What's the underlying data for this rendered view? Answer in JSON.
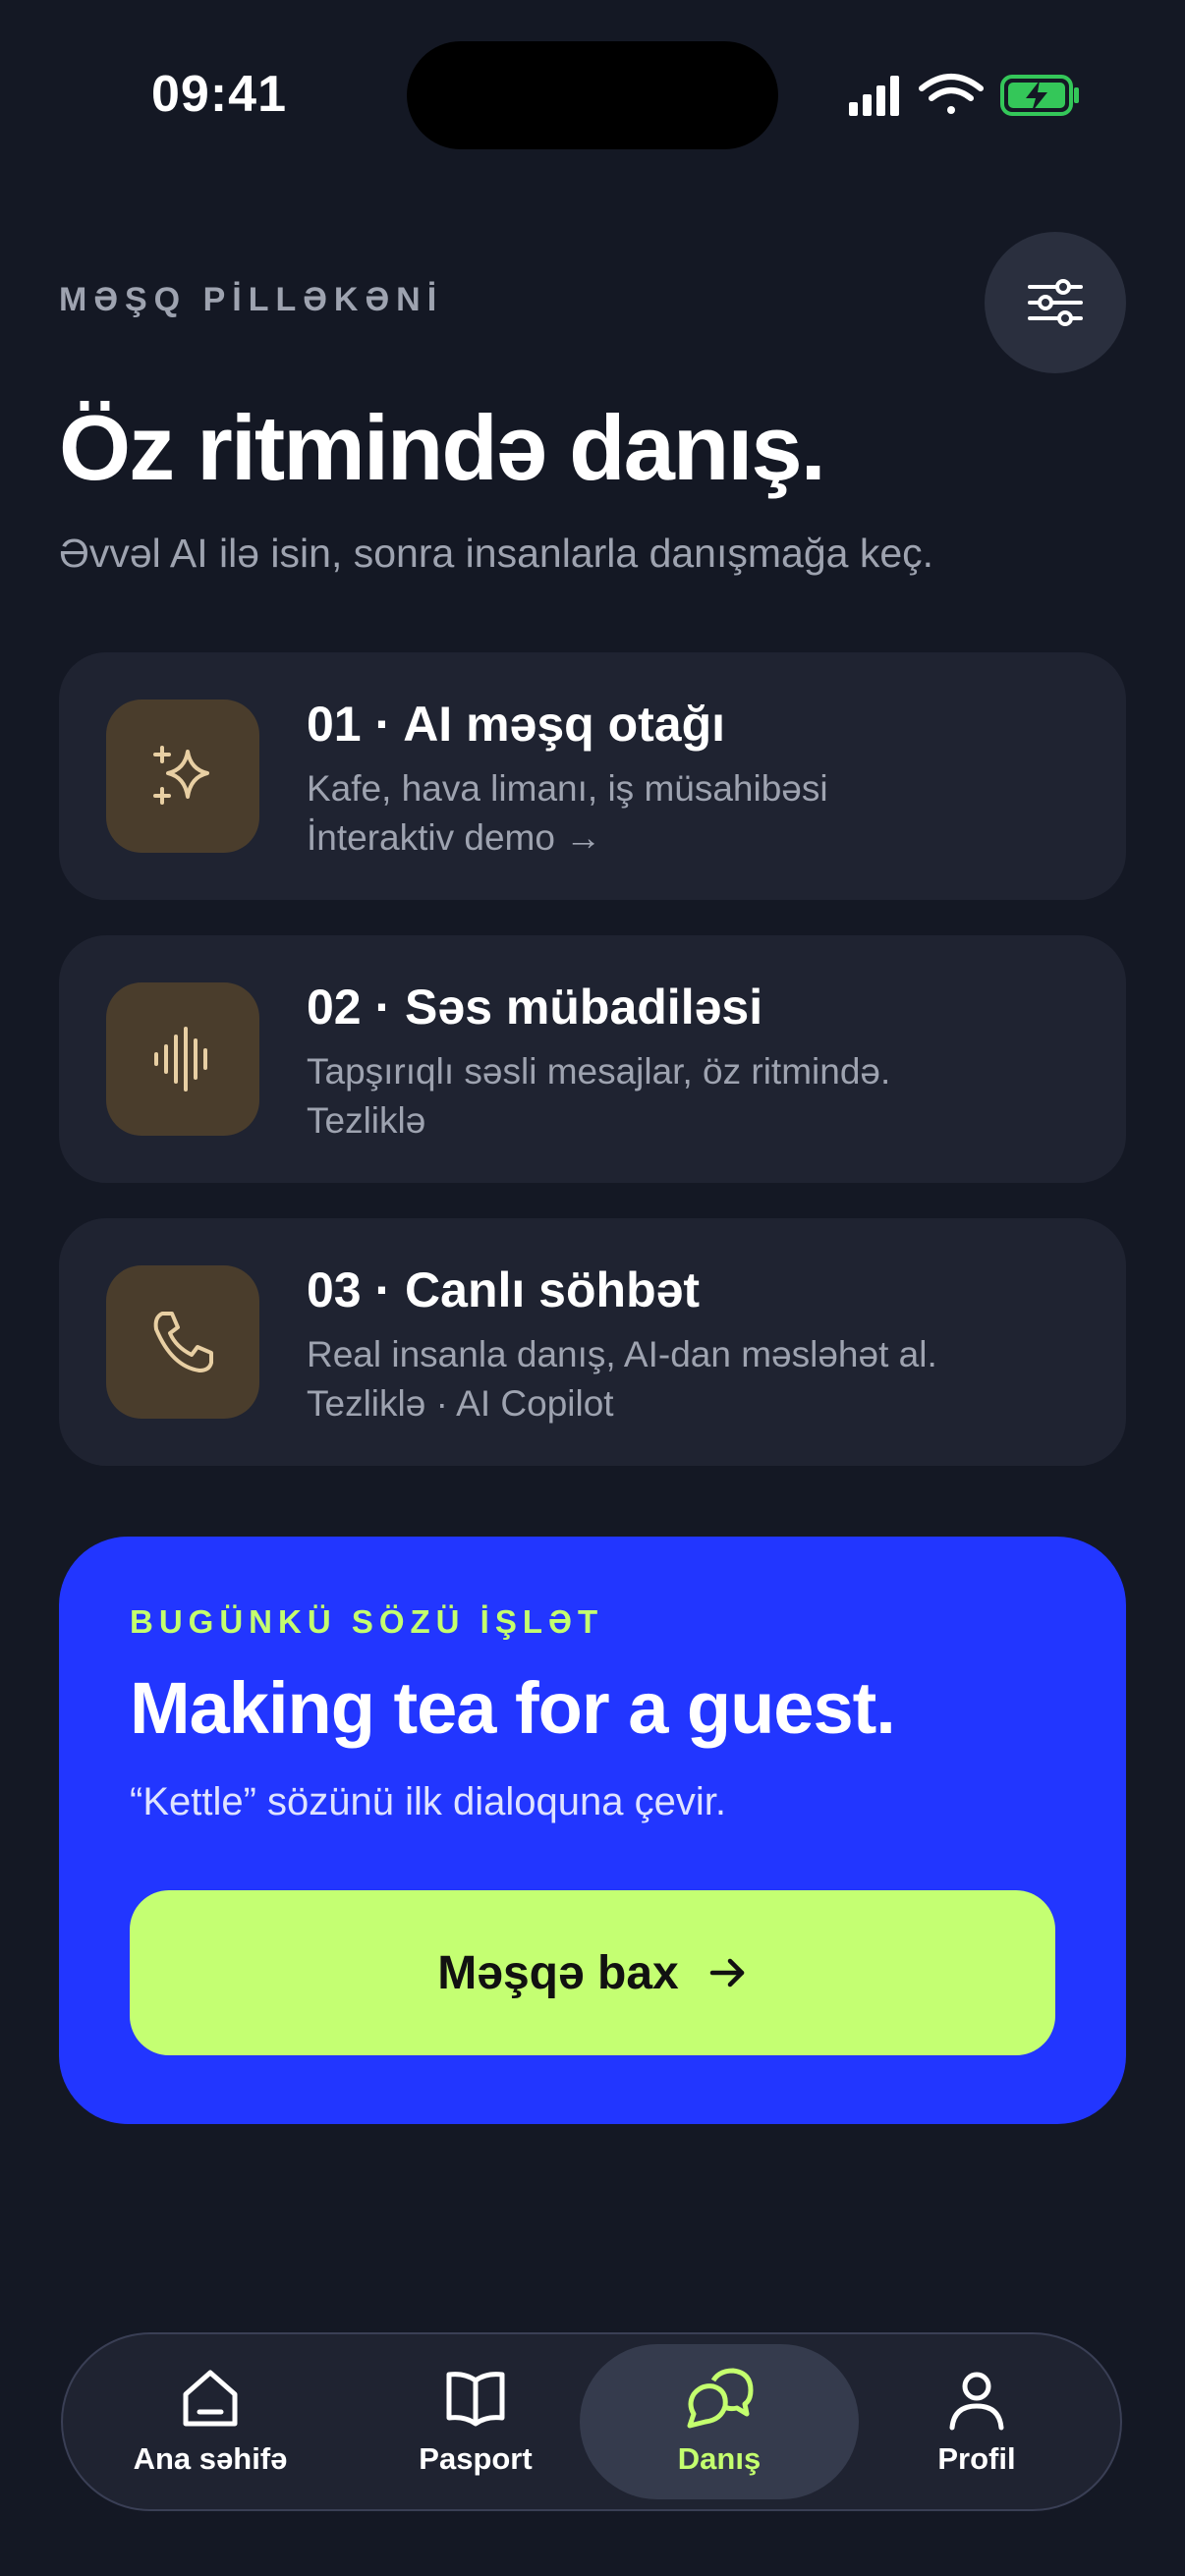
{
  "status": {
    "time": "09:41",
    "colors": {
      "battery": "#34c759"
    }
  },
  "header": {
    "eyebrow": "MƏŞQ PİLLƏKƏNİ",
    "title": "Öz ritmində danış.",
    "subtitle": "Əvvəl AI ilə isin, sonra insanlarla danışmağa keç.",
    "settings_icon": "sliders-icon"
  },
  "steps": [
    {
      "title": "01 · AI məşq otağı",
      "desc": "Kafe, hava limanı, iş müsahibəsi",
      "meta": "İnteraktiv demo →",
      "icon": "sparkles-icon"
    },
    {
      "title": "02 · Səs mübadiləsi",
      "desc": "Tapşırıqlı səsli mesajlar, öz ritmində.",
      "meta": "Tezliklə",
      "icon": "waveform-icon"
    },
    {
      "title": "03 · Canlı söhbət",
      "desc": "Real insanla danış, AI-dan məsləhət al.",
      "meta": "Tezliklə · AI Copilot",
      "icon": "phone-icon"
    }
  ],
  "promo": {
    "eyebrow": "BUGÜNKÜ SÖZÜ İŞLƏT",
    "title": "Making tea for a guest.",
    "subtitle": "“Kettle” sözünü ilk dialoquna çevir.",
    "button": "Məşqə bax",
    "colors": {
      "background": "#2236ff",
      "accent": "#c4ff72"
    }
  },
  "tabs": [
    {
      "label": "Ana səhifə",
      "icon": "home-icon",
      "active": false
    },
    {
      "label": "Pasport",
      "icon": "book-icon",
      "active": false
    },
    {
      "label": "Danış",
      "icon": "chat-icon",
      "active": true
    },
    {
      "label": "Profil",
      "icon": "user-icon",
      "active": false
    }
  ]
}
